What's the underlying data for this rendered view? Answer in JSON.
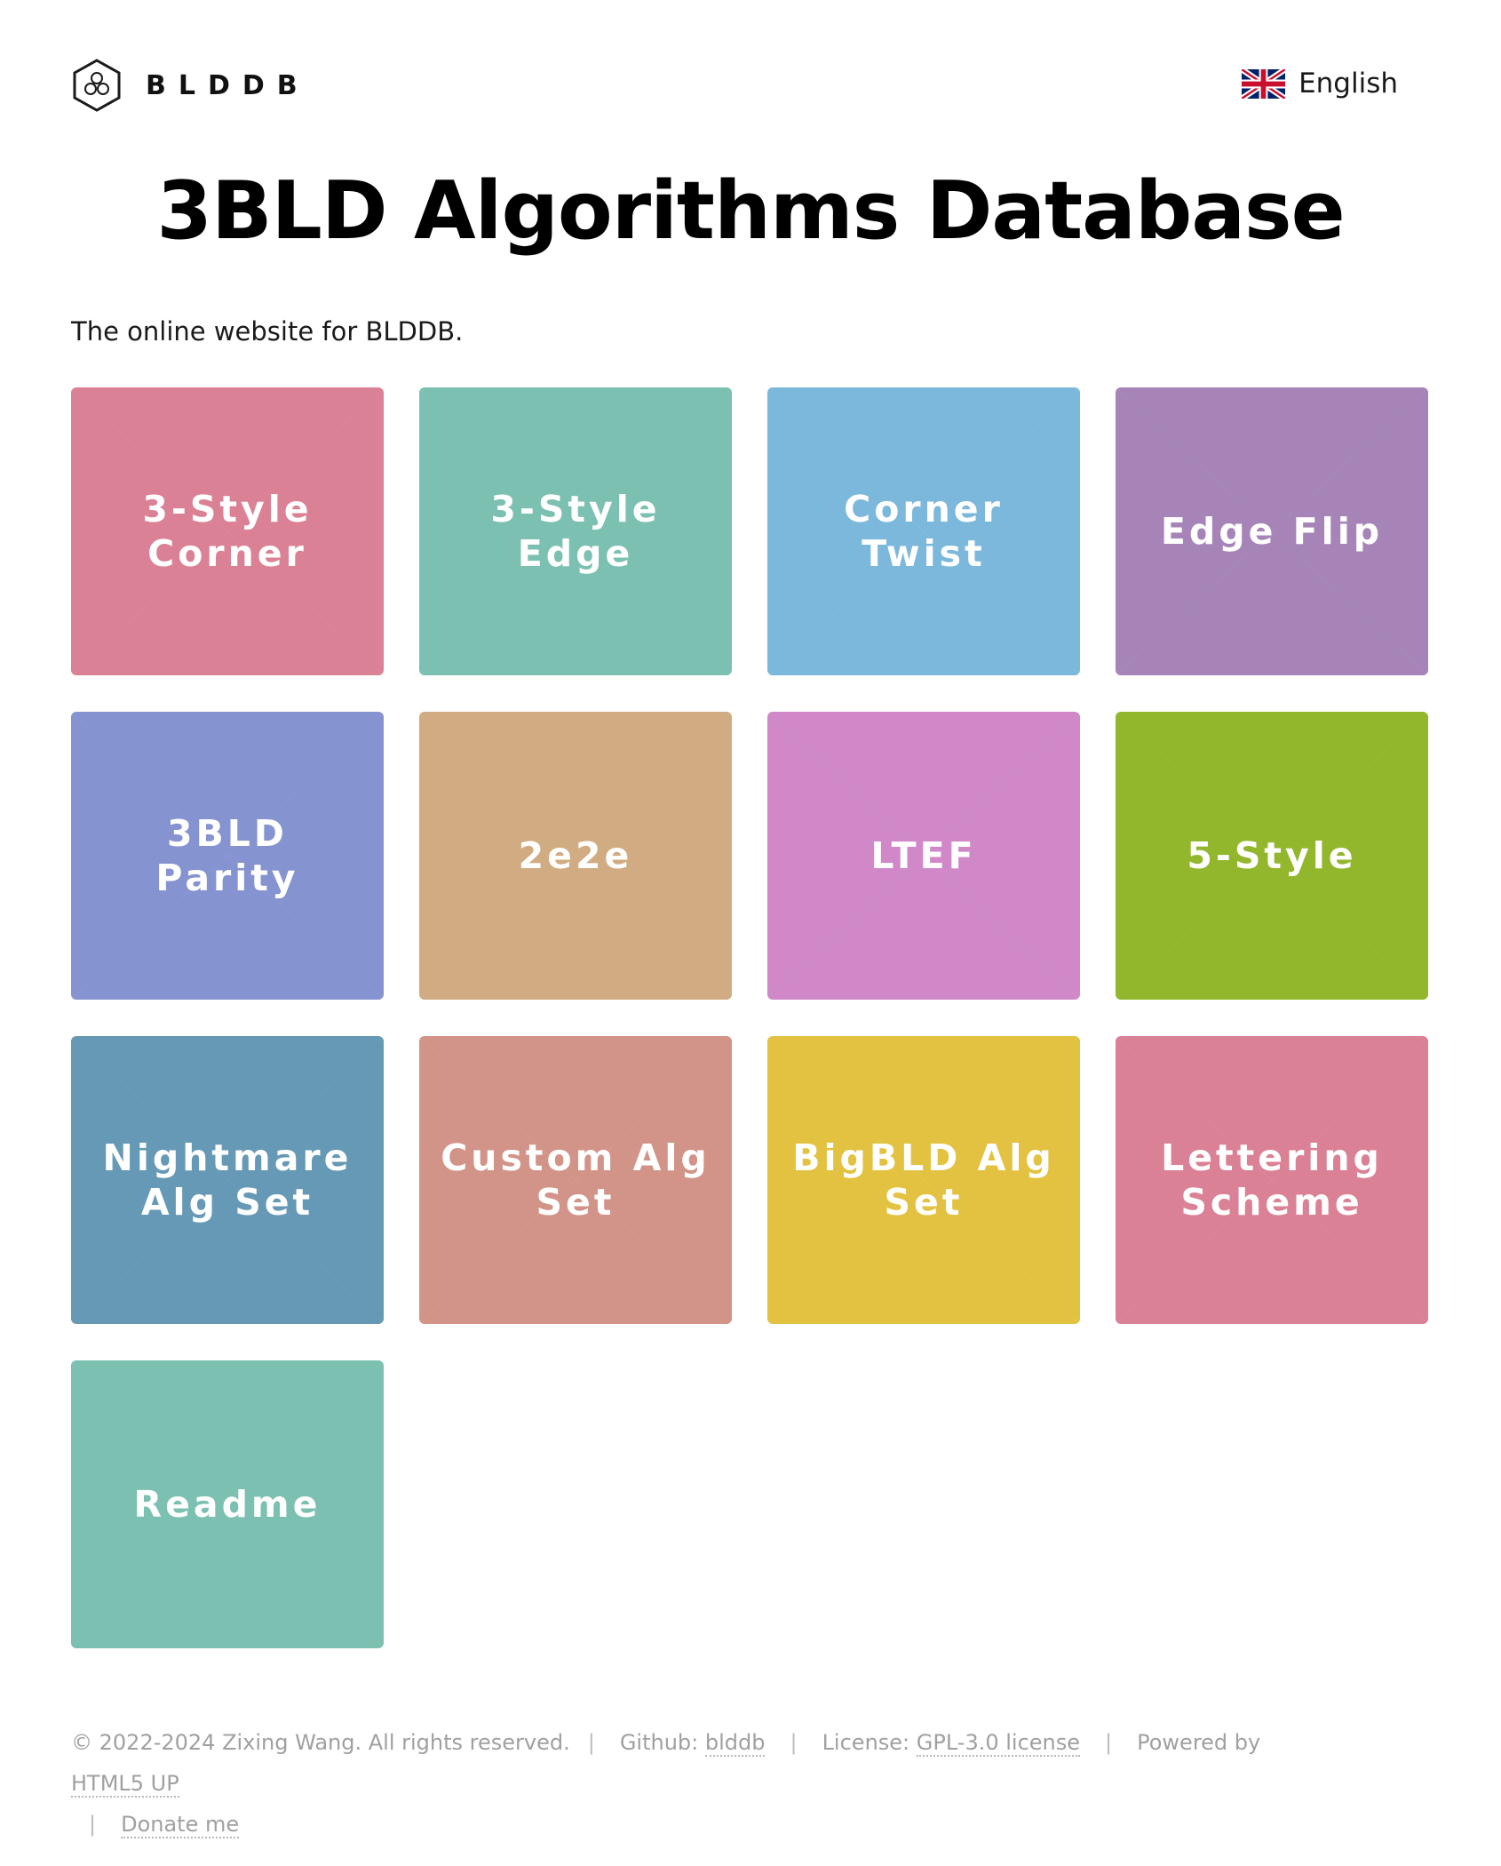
{
  "brand": {
    "name": "BLDDB",
    "logo_icon": "hexagon-cube-logo-icon"
  },
  "language": {
    "label": "English",
    "flag_icon": "uk-flag-icon"
  },
  "title": "3BLD Algorithms Database",
  "subtitle": "The online website for BLDDB.",
  "tiles": [
    {
      "label": "3-Style\nCorner",
      "color": "#DB8195"
    },
    {
      "label": "3-Style\nEdge",
      "color": "#7CC0B2"
    },
    {
      "label": "Corner\nTwist",
      "color": "#7CB8DB"
    },
    {
      "label": "Edge Flip",
      "color": "#A684B8"
    },
    {
      "label": "3BLD\nParity",
      "color": "#8593D0"
    },
    {
      "label": "2e2e",
      "color": "#D1AB82"
    },
    {
      "label": "LTEF",
      "color": "#D088C8"
    },
    {
      "label": "5-Style",
      "color": "#92B72C"
    },
    {
      "label": "Nightmare\nAlg Set",
      "color": "#6599B5"
    },
    {
      "label": "Custom Alg\nSet",
      "color": "#D29488"
    },
    {
      "label": "BigBLD Alg\nSet",
      "color": "#E3C242"
    },
    {
      "label": "Lettering\nScheme",
      "color": "#DB8195"
    },
    {
      "label": "Readme",
      "color": "#7CC0B2"
    }
  ],
  "footer": {
    "copyright": "© 2022-2024 Zixing Wang. All rights reserved.",
    "github_prefix": "Github: ",
    "github_link": "blddb",
    "license_prefix": "License: ",
    "license_link": "GPL-3.0 license",
    "powered_prefix": "Powered by ",
    "powered_link": "HTML5 UP",
    "donate_link": "Donate me",
    "separator": "|"
  }
}
